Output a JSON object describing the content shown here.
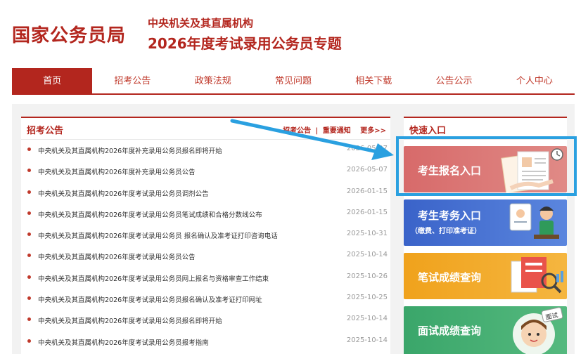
{
  "header": {
    "logo": "国家公务员局",
    "subtitle_top": "中央机关及其直属机构",
    "subtitle_main": "2026年度考试录用公务员专题"
  },
  "nav": [
    {
      "label": "首页",
      "active": true
    },
    {
      "label": "招考公告",
      "active": false
    },
    {
      "label": "政策法规",
      "active": false
    },
    {
      "label": "常见问题",
      "active": false
    },
    {
      "label": "相关下载",
      "active": false
    },
    {
      "label": "公告公示",
      "active": false
    },
    {
      "label": "个人中心",
      "active": false
    }
  ],
  "notice": {
    "title": "招考公告",
    "link_1": "招考公告",
    "separator": "|",
    "link_2": "重要通知",
    "more": "更多>>",
    "items": [
      {
        "text": "中央机关及其直属机构2026年度补充录用公务员报名即将开始",
        "date": "2026-05-07"
      },
      {
        "text": "中央机关及其直属机构2026年度补充录用公务员公告",
        "date": "2026-05-07"
      },
      {
        "text": "中央机关及其直属机构2026年度考试录用公务员调剂公告",
        "date": "2026-01-15"
      },
      {
        "text": "中央机关及其直属机构2026年度考试录用公务员笔试成绩和合格分数线公布",
        "date": "2026-01-15"
      },
      {
        "text": "中央机关及其直属机构2026年度考试录用公务员 报名确认及准考证打印咨询电话",
        "date": "2025-10-31"
      },
      {
        "text": "中央机关及其直属机构2026年度考试录用公务员公告",
        "date": "2025-10-14"
      },
      {
        "text": "中央机关及其直属机构2026年度考试录用公务员网上报名与资格审查工作结束",
        "date": "2025-10-26"
      },
      {
        "text": "中央机关及其直属机构2026年度考试录用公务员报名确认及准考证打印网址",
        "date": "2025-10-25"
      },
      {
        "text": "中央机关及其直属机构2026年度考试录用公务员报名即将开始",
        "date": "2025-10-14"
      },
      {
        "text": "中央机关及其直属机构2026年度考试录用公务员报考指南",
        "date": "2025-10-14"
      }
    ]
  },
  "quick": {
    "title": "快速入口",
    "btn1": "考生报名入口",
    "btn2": "考生考务入口",
    "btn2_sub": "（缴费、打印准考证）",
    "btn3": "笔试成绩查询",
    "btn4": "面试成绩查询",
    "btn4_badge": "面试"
  },
  "colors": {
    "brand_red": "#b3261e",
    "highlight_blue": "#2aa0e0"
  }
}
